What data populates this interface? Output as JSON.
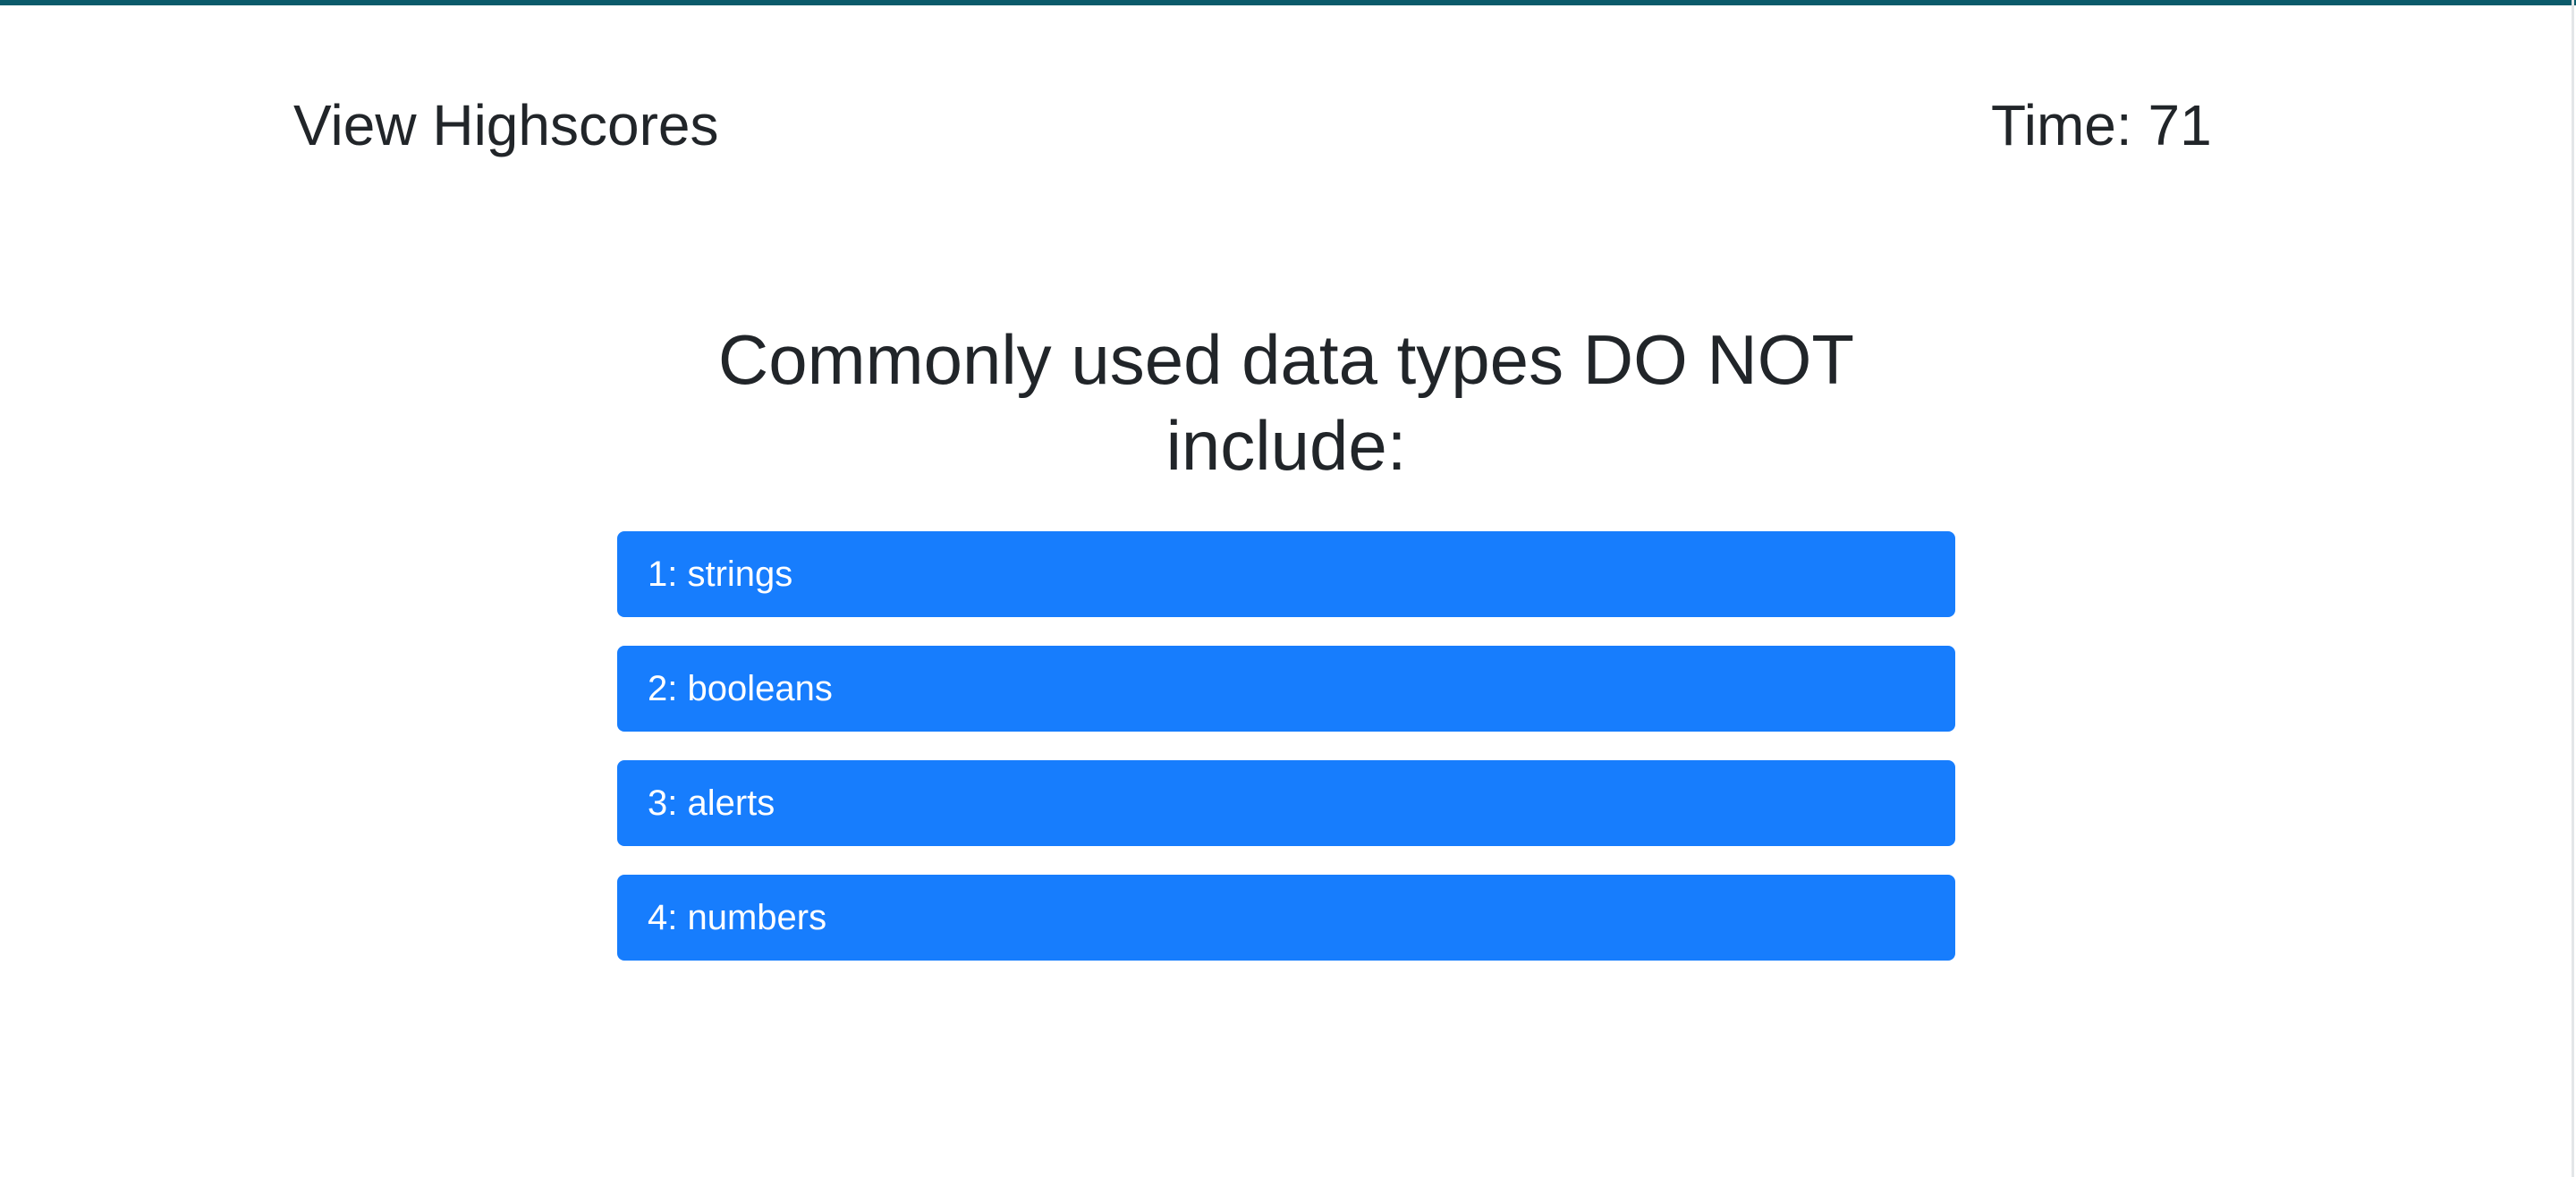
{
  "header": {
    "highscores_label": "View Highscores",
    "timer_label": "Time:",
    "timer_value": "71"
  },
  "quiz": {
    "question": "Commonly used data types DO NOT include:",
    "answers": [
      {
        "label": "1: strings"
      },
      {
        "label": "2: booleans"
      },
      {
        "label": "3: alerts"
      },
      {
        "label": "4: numbers"
      }
    ]
  },
  "colors": {
    "accent_bar": "#0b5b6b",
    "answer_button": "#177dfd",
    "text": "#212529"
  }
}
